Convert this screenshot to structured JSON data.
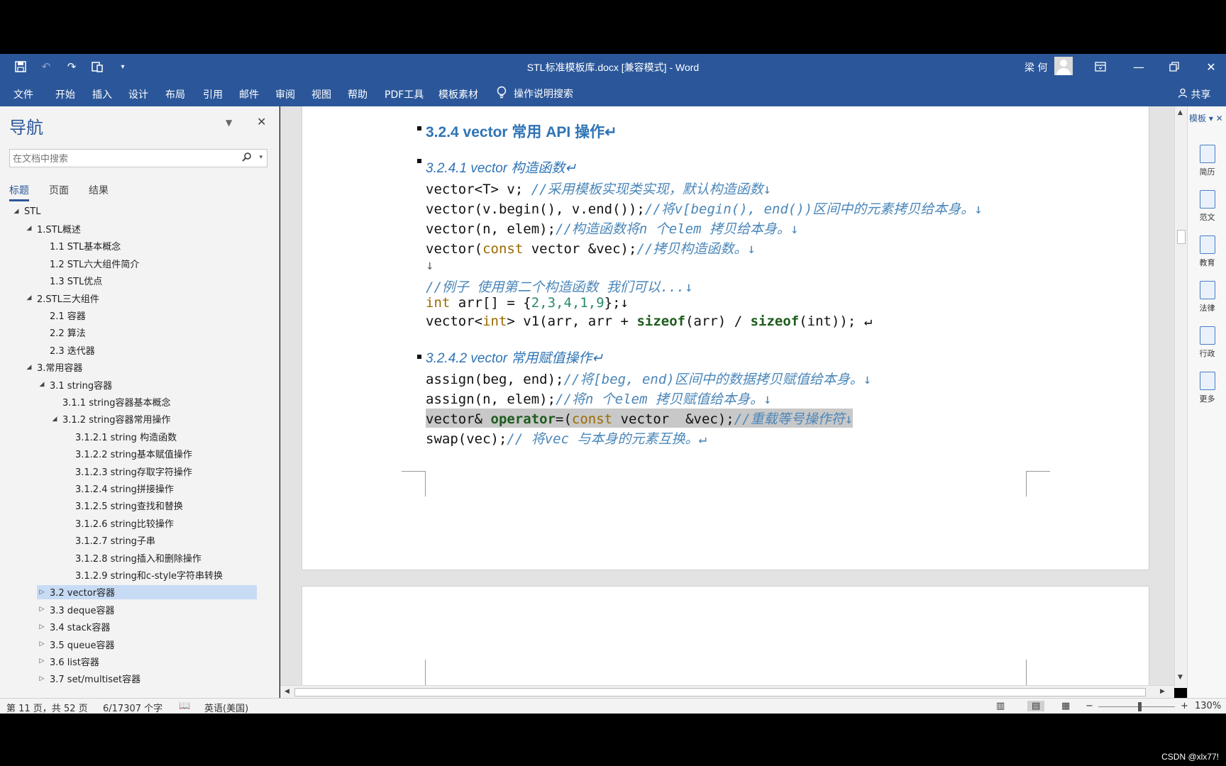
{
  "window": {
    "title": "STL标准模板库.docx [兼容模式]  -  Word",
    "user": "梁 何",
    "share": "共享"
  },
  "ribbon": {
    "tabs": [
      "文件",
      "开始",
      "插入",
      "设计",
      "布局",
      "引用",
      "邮件",
      "审阅",
      "视图",
      "帮助",
      "PDF工具",
      "模板素材"
    ],
    "tellme": "操作说明搜索"
  },
  "nav": {
    "title": "导航",
    "search_placeholder": "在文档中搜索",
    "tabs": [
      "标题",
      "页面",
      "结果"
    ],
    "tree": [
      {
        "label": "STL",
        "level": 0,
        "toggle": "◢"
      },
      {
        "label": "1.STL概述",
        "level": 1,
        "toggle": "◢"
      },
      {
        "label": "1.1 STL基本概念",
        "level": 2,
        "toggle": ""
      },
      {
        "label": "1.2 STL六大组件简介",
        "level": 2,
        "toggle": ""
      },
      {
        "label": "1.3 STL优点",
        "level": 2,
        "toggle": ""
      },
      {
        "label": "2.STL三大组件",
        "level": 1,
        "toggle": "◢"
      },
      {
        "label": "2.1 容器",
        "level": 2,
        "toggle": ""
      },
      {
        "label": "2.2 算法",
        "level": 2,
        "toggle": ""
      },
      {
        "label": "2.3 迭代器",
        "level": 2,
        "toggle": ""
      },
      {
        "label": "3.常用容器",
        "level": 1,
        "toggle": "◢"
      },
      {
        "label": "3.1 string容器",
        "level": 2,
        "toggle": "◢"
      },
      {
        "label": "3.1.1 string容器基本概念",
        "level": 3,
        "toggle": ""
      },
      {
        "label": "3.1.2 string容器常用操作",
        "level": 3,
        "toggle": "◢"
      },
      {
        "label": "3.1.2.1 string 构造函数",
        "level": 4,
        "toggle": ""
      },
      {
        "label": "3.1.2.2 string基本赋值操作",
        "level": 4,
        "toggle": ""
      },
      {
        "label": "3.1.2.3 string存取字符操作",
        "level": 4,
        "toggle": ""
      },
      {
        "label": "3.1.2.4 string拼接操作",
        "level": 4,
        "toggle": ""
      },
      {
        "label": "3.1.2.5 string查找和替换",
        "level": 4,
        "toggle": ""
      },
      {
        "label": "3.1.2.6 string比较操作",
        "level": 4,
        "toggle": ""
      },
      {
        "label": "3.1.2.7 string子串",
        "level": 4,
        "toggle": ""
      },
      {
        "label": "3.1.2.8 string插入和删除操作",
        "level": 4,
        "toggle": ""
      },
      {
        "label": "3.1.2.9 string和c-style字符串转换",
        "level": 4,
        "toggle": ""
      },
      {
        "label": "3.2 vector容器",
        "level": 2,
        "toggle": "▷",
        "selected": true
      },
      {
        "label": "3.3 deque容器",
        "level": 2,
        "toggle": "▷"
      },
      {
        "label": "3.4 stack容器",
        "level": 2,
        "toggle": "▷"
      },
      {
        "label": "3.5 queue容器",
        "level": 2,
        "toggle": "▷"
      },
      {
        "label": "3.6 list容器",
        "level": 2,
        "toggle": "▷"
      },
      {
        "label": "3.7 set/multiset容器",
        "level": 2,
        "toggle": "▷"
      }
    ]
  },
  "document": {
    "h_324": "3.2.4 vector 常用 API 操作↵",
    "h_3241": "3.2.4.1 vector 构造函数↵",
    "c1_code": "vector<T> v; ",
    "c1_cmt": "//采用模板实现类实现，默认构造函数↓",
    "c2_code": "vector(v.begin(), v.end());",
    "c2_cmt": "//将v[begin(), end())区间中的元素拷贝给本身。↓",
    "c3_code": "vector(n, elem);",
    "c3_cmt": "//构造函数将n 个elem 拷贝给本身。↓",
    "c4_a": "vector(",
    "c4_kw": "const",
    "c4_b": " vector &vec);",
    "c4_cmt": "//拷贝构造函数。↓",
    "c5": "↓",
    "c6_cmt": "//例子 使用第二个构造函数 我们可以...↓",
    "c7_kw": "int",
    "c7_a": " arr[] = {",
    "c7_nums": "2,3,4,1,9",
    "c7_b": "};↓",
    "c8_a": "vector<",
    "c8_kw": "int",
    "c8_b": "> v1(arr, arr + ",
    "c8_sizeof1": "sizeof",
    "c8_c": "(arr) / ",
    "c8_sizeof2": "sizeof",
    "c8_d": "(int)); ↵",
    "h_3242": "3.2.4.2 vector 常用赋值操作↵",
    "d1_code": "assign(beg, end);",
    "d1_cmt": "//将[beg, end)区间中的数据拷贝赋值给本身。↓",
    "d2_code": "assign(n, elem);",
    "d2_cmt": "//将n 个elem 拷贝赋值给本身。↓",
    "d3_a": "vector& ",
    "d3_op": "operator",
    "d3_b": "=(",
    "d3_kw": "const",
    "d3_c": " vector  &vec);",
    "d3_cmt": "//重载等号操作符↓",
    "d4_code": "swap(vec);",
    "d4_cmt": "// 将vec 与本身的元素互换。↵"
  },
  "template_pane": {
    "title": "模板 ▾",
    "items": [
      "简历",
      "范文",
      "教育",
      "法律",
      "行政",
      "更多"
    ]
  },
  "status": {
    "page": "第 11 页，共 52 页",
    "words": "6/17307 个字",
    "language": "英语(美国)",
    "zoom": "130%"
  },
  "watermark": "CSDN @xlx77!"
}
